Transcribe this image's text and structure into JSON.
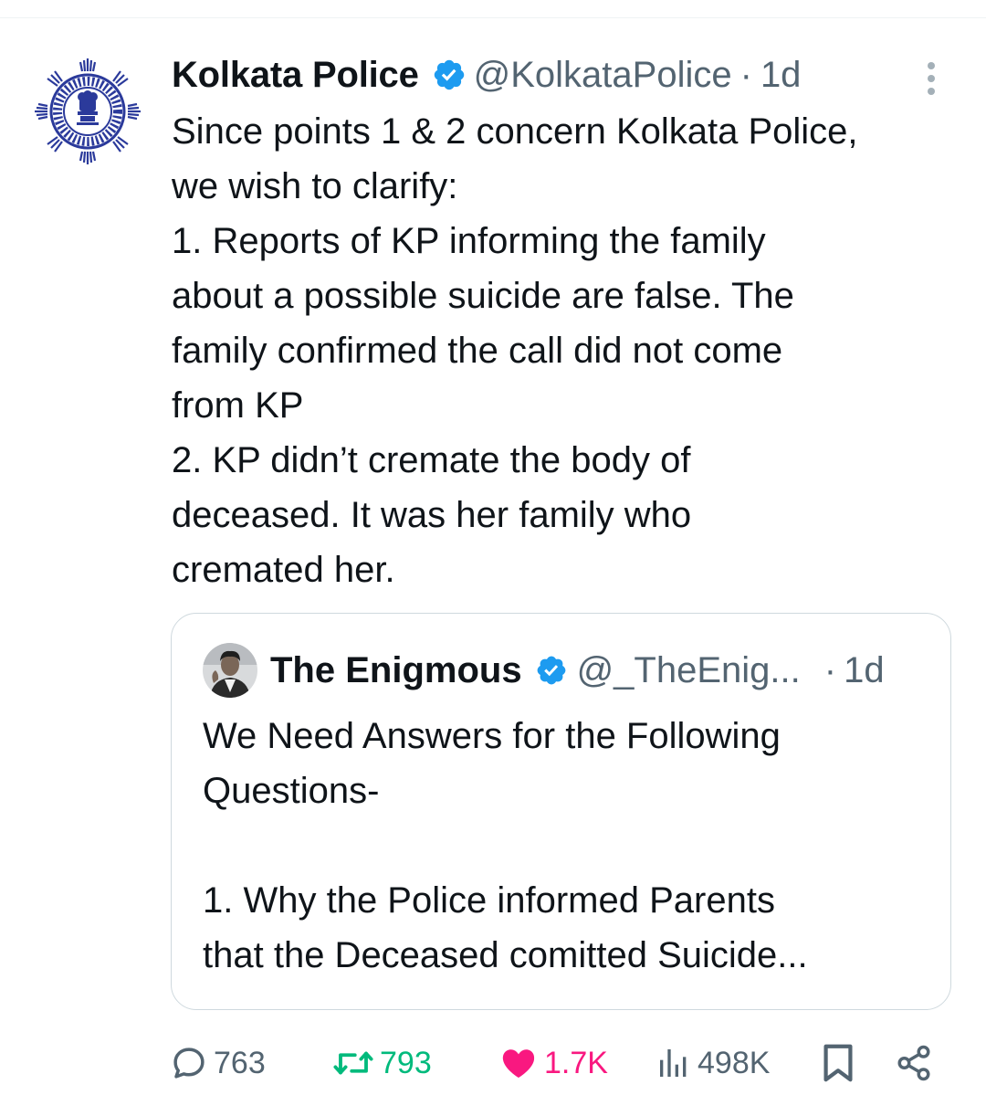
{
  "tweet": {
    "display_name": "Kolkata Police",
    "handle": "@KolkataPolice",
    "separator": "·",
    "time": "1d",
    "avatar_icon": "kolkata-police-emblem",
    "verified_icon": "verified-badge-icon",
    "more_icon": "more-vertical-icon",
    "text_lines": [
      "Since points 1 & 2 concern Kolkata Police,",
      "we wish to clarify:",
      "1. Reports of KP informing the family",
      "about a possible suicide are false. The",
      "family confirmed the call did not come",
      "from KP",
      "2. KP didn’t cremate the body of",
      "deceased. It was her family who",
      "cremated her."
    ]
  },
  "quoted_tweet": {
    "display_name": "The Enigmous",
    "handle": "@_TheEnig...",
    "separator": "·",
    "time": "1d",
    "text_lines": [
      "We Need Answers for the Following",
      "Questions-",
      "",
      "1. Why the Police informed Parents",
      "that the Deceased comitted Suicide..."
    ]
  },
  "actions": {
    "replies": "763",
    "reposts": "793",
    "likes": "1.7K",
    "views": "498K",
    "bookmark_icon": "bookmark-icon",
    "share_icon": "share-icon"
  },
  "colors": {
    "text": "#0f1419",
    "muted": "#536471",
    "verified": "#1d9bf0",
    "repost": "#00ba7c",
    "like": "#f91880",
    "emblem": "#2b3a9b",
    "border": "#cfd9de"
  }
}
